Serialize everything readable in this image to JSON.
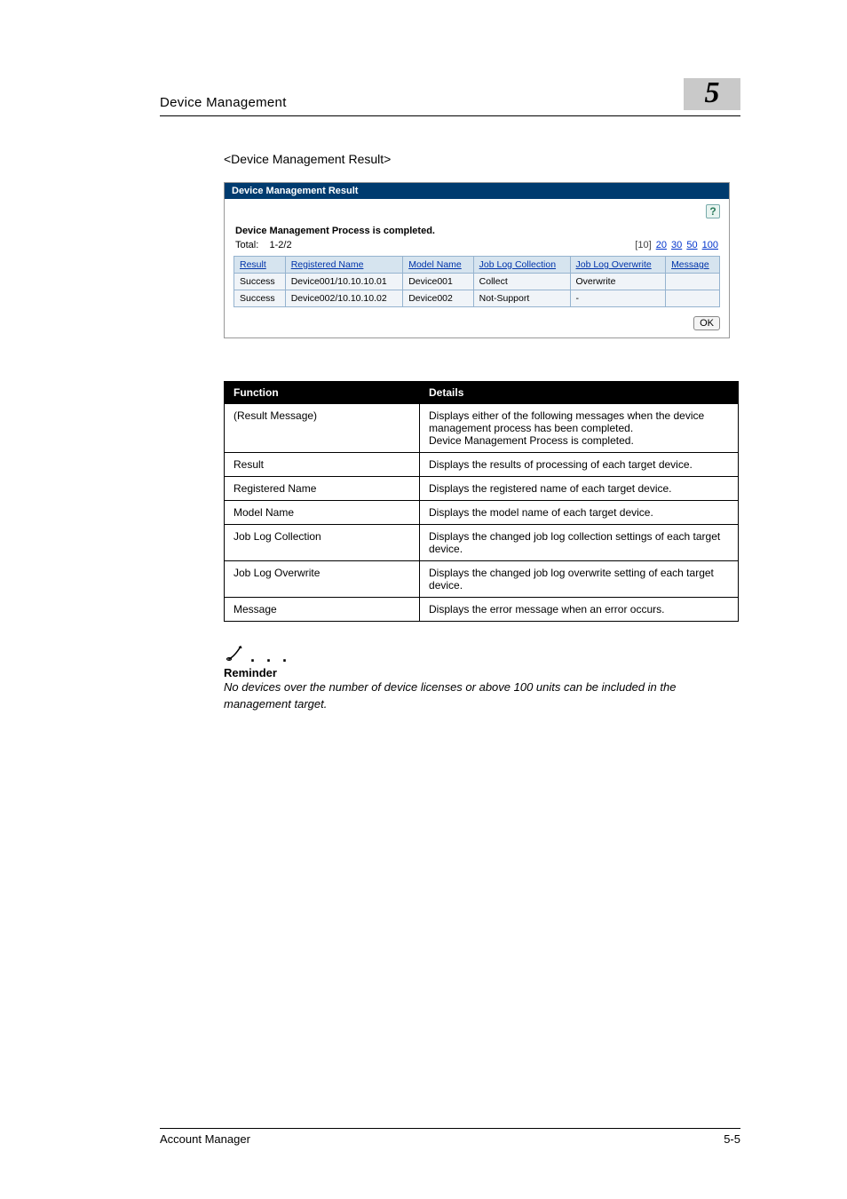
{
  "header": {
    "section_title": "Device Management",
    "chapter_number": "5"
  },
  "subheading": "<Device Management Result>",
  "screenshot": {
    "titlebar": "Device Management Result",
    "help_glyph": "?",
    "status_line": "Device Management Process is completed.",
    "total_label": "Total:",
    "total_value": "1-2/2",
    "pager": {
      "items": [
        "[10]",
        "20",
        "30",
        "50",
        "100"
      ]
    },
    "columns": [
      "Result",
      "Registered Name",
      "Model Name",
      "Job Log Collection",
      "Job Log Overwrite",
      "Message"
    ],
    "rows": [
      {
        "result": "Success",
        "name": "Device001/10.10.10.01",
        "model": "Device001",
        "collection": "Collect",
        "overwrite": "Overwrite",
        "message": ""
      },
      {
        "result": "Success",
        "name": "Device002/10.10.10.02",
        "model": "Device002",
        "collection": "Not-Support",
        "overwrite": "-",
        "message": ""
      }
    ],
    "ok_label": "OK"
  },
  "func_table": {
    "head": {
      "function": "Function",
      "details": "Details"
    },
    "rows": [
      {
        "function": "(Result Message)",
        "details": "Displays either of the following messages when the device management process has been completed.\nDevice Management Process is completed."
      },
      {
        "function": "Result",
        "details": "Displays the results of processing of each target device."
      },
      {
        "function": "Registered Name",
        "details": "Displays the registered name of each target device."
      },
      {
        "function": "Model Name",
        "details": "Displays the model name of each target device."
      },
      {
        "function": "Job Log Collection",
        "details": "Displays the changed job log collection settings of each target device."
      },
      {
        "function": "Job Log Overwrite",
        "details": "Displays the changed job log overwrite setting of each target device."
      },
      {
        "function": "Message",
        "details": "Displays the error message when an error occurs."
      }
    ]
  },
  "note": {
    "dots": ". . .",
    "heading": "Reminder",
    "body": "No devices over the number of device licenses or above 100 units can be included in the management target."
  },
  "footer": {
    "left": "Account Manager",
    "right": "5-5"
  }
}
